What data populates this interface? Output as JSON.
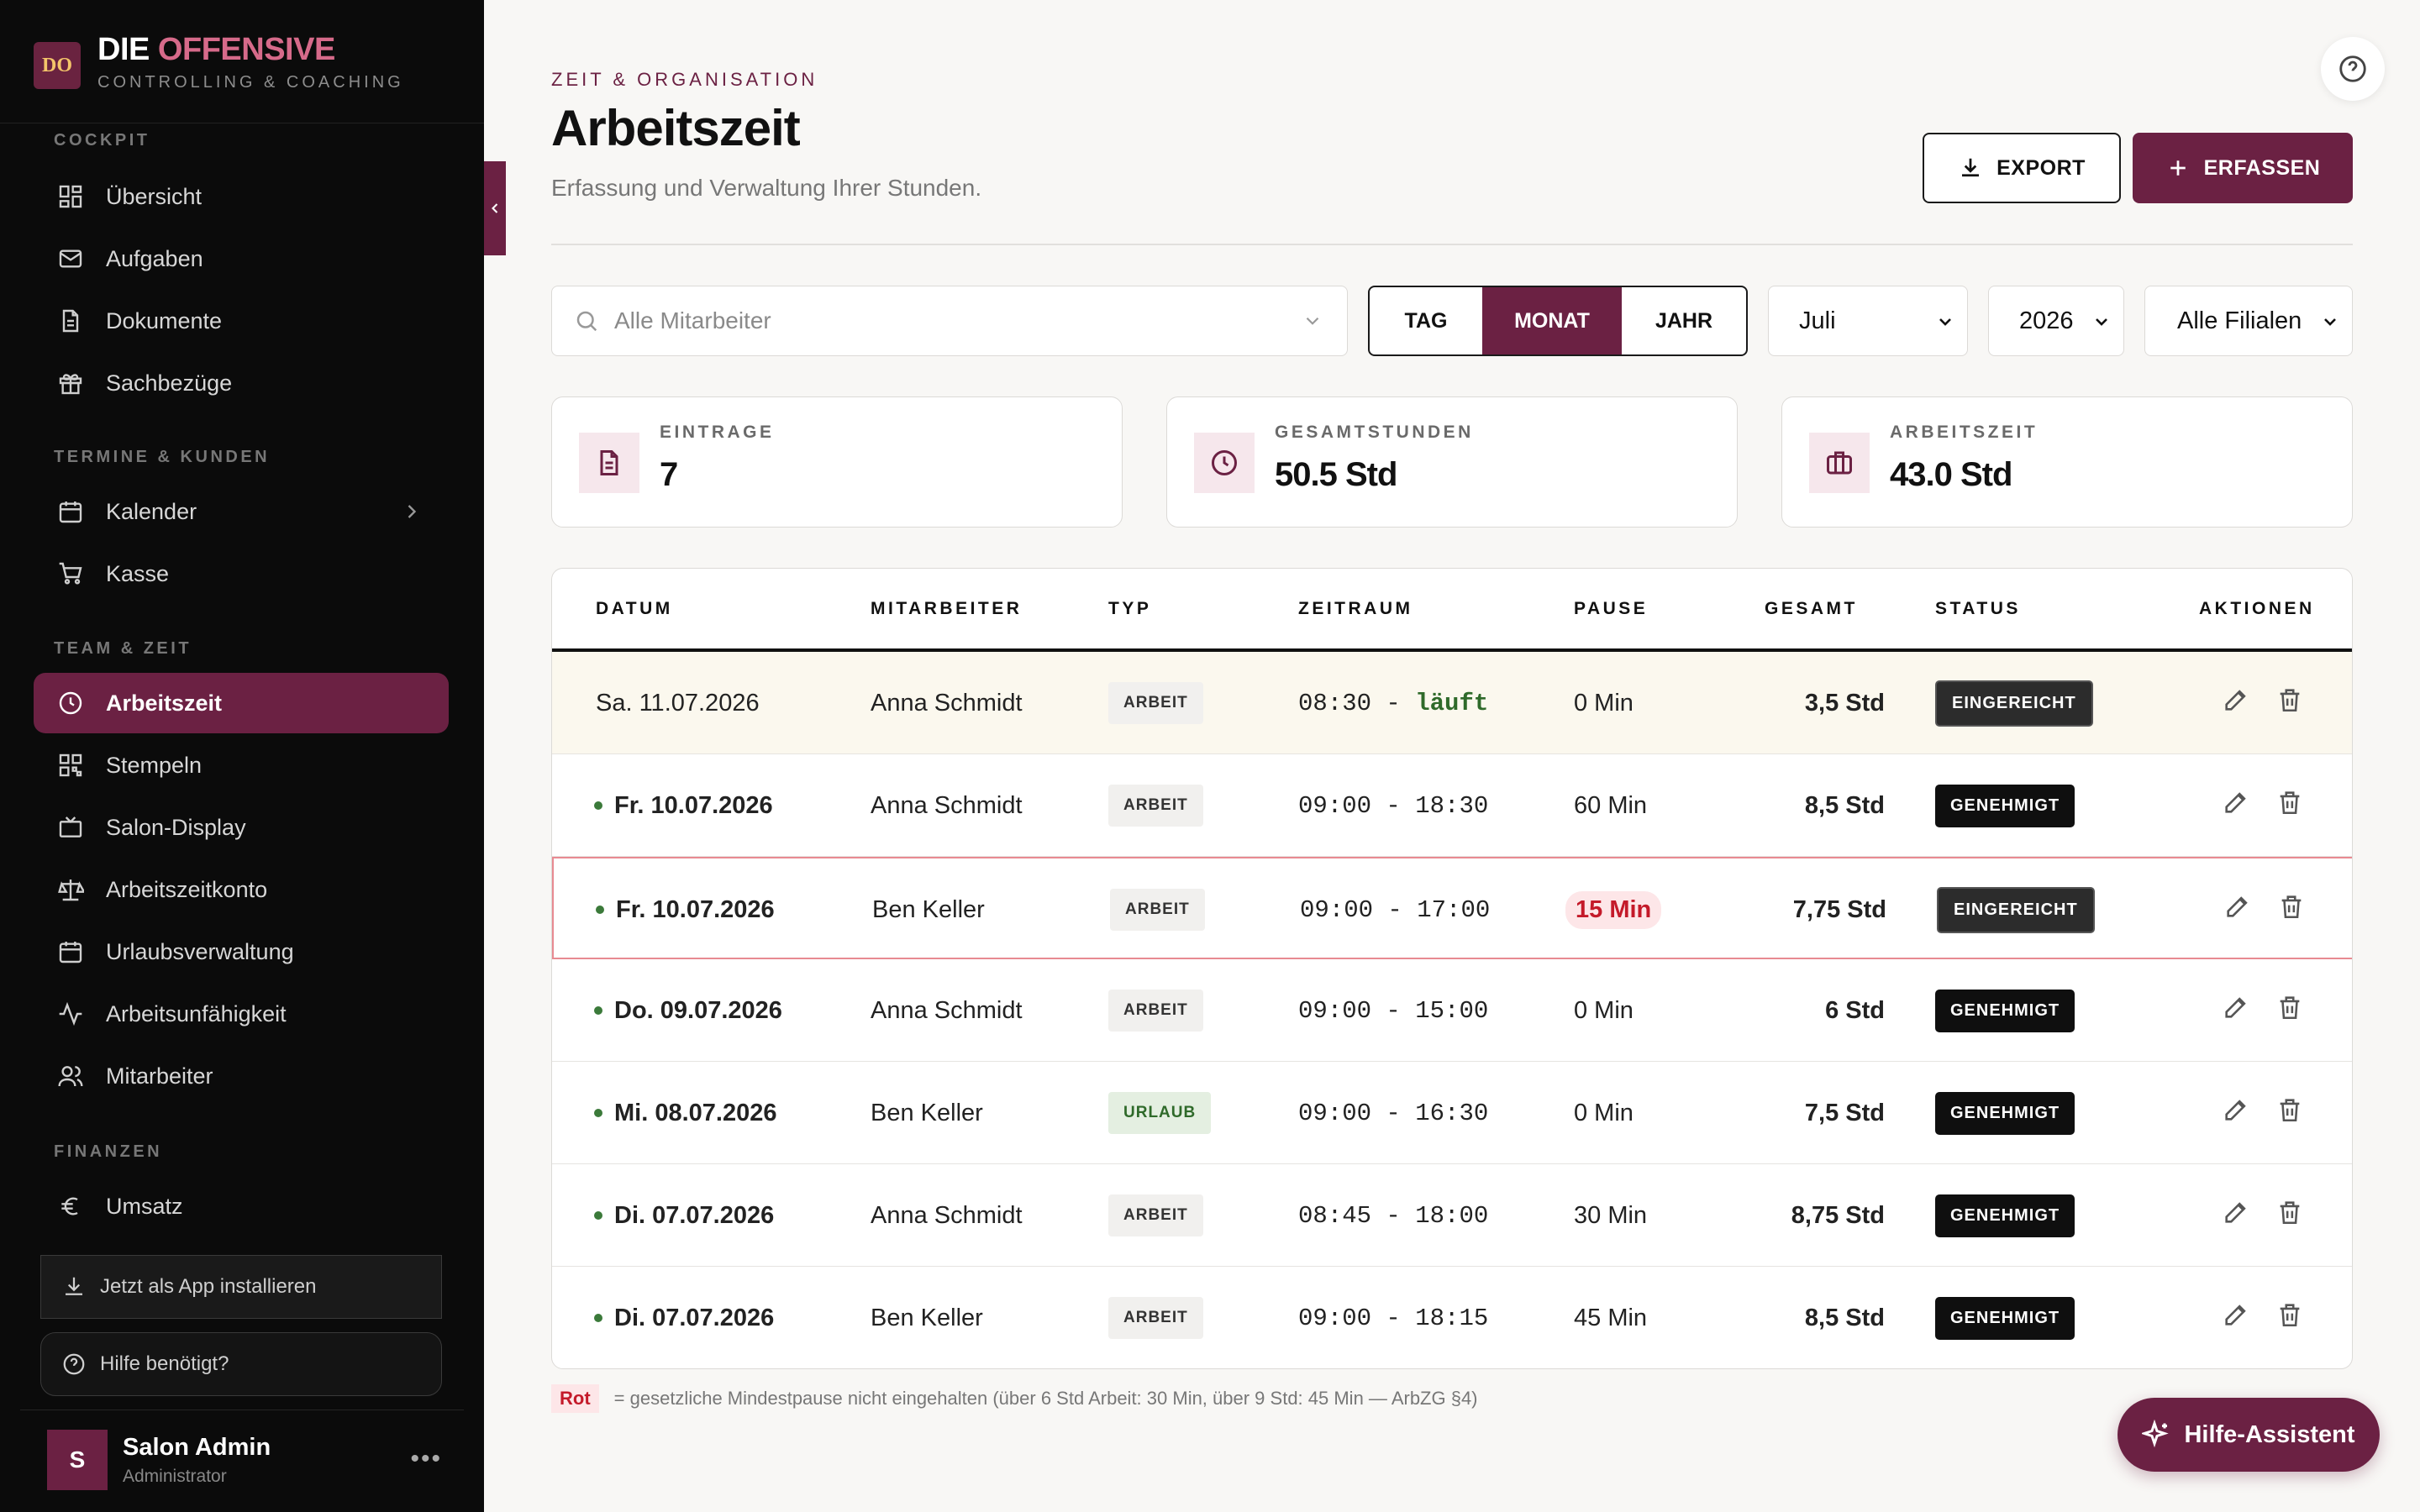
{
  "brand": {
    "logo": "DO",
    "title_part1": "DIE",
    "title_part2": "OFFENSIVE",
    "subtitle": "CONTROLLING & COACHING"
  },
  "sidebar": {
    "sections": [
      {
        "label": "COCKPIT",
        "items": [
          {
            "label": "Übersicht",
            "icon": "dashboard-icon"
          },
          {
            "label": "Aufgaben",
            "icon": "mail-icon"
          },
          {
            "label": "Dokumente",
            "icon": "document-icon"
          },
          {
            "label": "Sachbezüge",
            "icon": "gift-icon"
          }
        ]
      },
      {
        "label": "TERMINE & KUNDEN",
        "items": [
          {
            "label": "Kalender",
            "icon": "calendar-icon"
          },
          {
            "label": "Kasse",
            "icon": "cart-icon"
          }
        ]
      },
      {
        "label": "TEAM & ZEIT",
        "items": [
          {
            "label": "Arbeitszeit",
            "icon": "clock-icon",
            "active": true
          },
          {
            "label": "Stempeln",
            "icon": "qr-icon"
          },
          {
            "label": "Salon-Display",
            "icon": "tv-icon"
          },
          {
            "label": "Arbeitszeitkonto",
            "icon": "scale-icon"
          },
          {
            "label": "Urlaubsverwaltung",
            "icon": "calendar-icon"
          },
          {
            "label": "Arbeitsunfähigkeit",
            "icon": "activity-icon"
          },
          {
            "label": "Mitarbeiter",
            "icon": "users-icon"
          }
        ]
      },
      {
        "label": "FINANZEN",
        "items": [
          {
            "label": "Umsatz",
            "icon": "euro-icon"
          }
        ]
      }
    ],
    "install_label": "Jetzt als App installieren",
    "help_label": "Hilfe benötigt?",
    "user": {
      "initial": "S",
      "name": "Salon Admin",
      "role": "Administrator",
      "more": "•••"
    }
  },
  "header": {
    "eyebrow": "ZEIT & ORGANISATION",
    "title": "Arbeitszeit",
    "subtitle": "Erfassung und Verwaltung Ihrer Stunden.",
    "export_label": "EXPORT",
    "add_label": "ERFASSEN"
  },
  "filters": {
    "employee_placeholder": "Alle Mitarbeiter",
    "views": [
      "TAG",
      "MONAT",
      "JAHR"
    ],
    "active_view": "MONAT",
    "month": "Juli",
    "year": "2026",
    "branch": "Alle Filialen"
  },
  "stats": [
    {
      "label": "EINTRAGE",
      "value": "7",
      "icon": "document-icon"
    },
    {
      "label": "GESAMTSTUNDEN",
      "value": "50.5 Std",
      "icon": "clock-icon"
    },
    {
      "label": "ARBEITSZEIT",
      "value": "43.0 Std",
      "icon": "briefcase-icon"
    }
  ],
  "table": {
    "headers": [
      "DATUM",
      "MITARBEITER",
      "TYP",
      "ZEITRAUM",
      "PAUSE",
      "GESAMT",
      "STATUS",
      "AKTIONEN"
    ],
    "rows": [
      {
        "date": "Sa. 11.07.2026",
        "employee": "Anna Schmidt",
        "type": "ARBEIT",
        "start": "08:30",
        "sep": " - ",
        "end": "läuft",
        "pause": "0 Min",
        "total": "3,5 Std",
        "status": "EINGEREICHT",
        "running": true
      },
      {
        "date": "Fr. 10.07.2026",
        "employee": "Anna Schmidt",
        "type": "ARBEIT",
        "start": "09:00",
        "sep": " - ",
        "end": "18:30",
        "pause": "60 Min",
        "total": "8,5 Std",
        "status": "GENEHMIGT"
      },
      {
        "date": "Fr. 10.07.2026",
        "employee": "Ben Keller",
        "type": "ARBEIT",
        "start": "09:00",
        "sep": " - ",
        "end": "17:00",
        "pause": "15 Min",
        "total": "7,75 Std",
        "status": "EINGEREICHT",
        "violation": true
      },
      {
        "date": "Do. 09.07.2026",
        "employee": "Anna Schmidt",
        "type": "ARBEIT",
        "start": "09:00",
        "sep": " - ",
        "end": "15:00",
        "pause": "0 Min",
        "total": "6 Std",
        "status": "GENEHMIGT"
      },
      {
        "date": "Mi. 08.07.2026",
        "employee": "Ben Keller",
        "type": "URLAUB",
        "start": "09:00",
        "sep": " - ",
        "end": "16:30",
        "pause": "0 Min",
        "total": "7,5 Std",
        "status": "GENEHMIGT"
      },
      {
        "date": "Di. 07.07.2026",
        "employee": "Anna Schmidt",
        "type": "ARBEIT",
        "start": "08:45",
        "sep": " - ",
        "end": "18:00",
        "pause": "30 Min",
        "total": "8,75 Std",
        "status": "GENEHMIGT"
      },
      {
        "date": "Di. 07.07.2026",
        "employee": "Ben Keller",
        "type": "ARBEIT",
        "start": "09:00",
        "sep": " - ",
        "end": "18:15",
        "pause": "45 Min",
        "total": "8,5 Std",
        "status": "GENEHMIGT"
      }
    ]
  },
  "legend": {
    "tag": "Rot",
    "text": "= gesetzliche Mindestpause nicht eingehalten (über 6 Std Arbeit: 30 Min, über 9 Std: 45 Min — ArbZG §4)"
  },
  "assistant_label": "Hilfe-Assistent",
  "colors": {
    "brand": "#6b2143",
    "sidebar": "#0b0b0b",
    "warning": "#c41a2a",
    "success": "#2f6a2a"
  }
}
